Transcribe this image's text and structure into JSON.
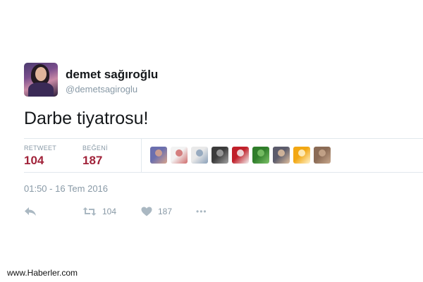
{
  "user": {
    "display_name": "demet sağıroğlu",
    "handle": "@demetsagiroglu"
  },
  "tweet": {
    "text": "Darbe tiyatrosu!",
    "timestamp": "01:50 - 16 Tem 2016"
  },
  "stats": {
    "retweet_label": "RETWEET",
    "retweet_count": "104",
    "like_label": "BEĞENİ",
    "like_count": "187"
  },
  "actions": {
    "retweet_count": "104",
    "like_count": "187",
    "more_label": "•••"
  },
  "likers": [
    {
      "colors": [
        "#6b6fae",
        "#d9a48c"
      ]
    },
    {
      "colors": [
        "#f3f3f3",
        "#cf6b6b"
      ]
    },
    {
      "colors": [
        "#e9e9e9",
        "#8aa0b8"
      ]
    },
    {
      "colors": [
        "#3b3b3b",
        "#a3a3a3"
      ]
    },
    {
      "colors": [
        "#c0202a",
        "#f4f4f4"
      ]
    },
    {
      "colors": [
        "#2f7d2a",
        "#7ec36a"
      ]
    },
    {
      "colors": [
        "#5b5b6b",
        "#e0c0a0"
      ]
    },
    {
      "colors": [
        "#f2a713",
        "#fff3cf"
      ]
    },
    {
      "colors": [
        "#8b6b55",
        "#c9a98e"
      ]
    }
  ],
  "watermark": "www.Haberler.com",
  "colors": {
    "accent_count": "#a1233a",
    "muted": "#8899a6",
    "icon": "#aab8c2"
  }
}
